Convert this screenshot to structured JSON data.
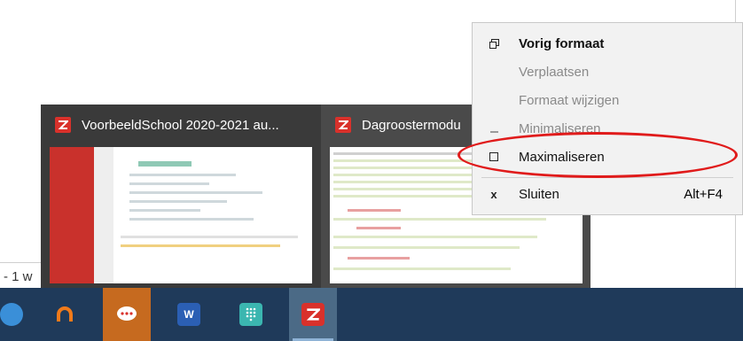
{
  "background": {
    "status_fragment": "- 1 w"
  },
  "thumbnails": [
    {
      "title": "VoorbeeldSchool 2020-2021 au...",
      "icon": "zermelo-logo-icon"
    },
    {
      "title": "Dagroostermodu",
      "icon": "zermelo-logo-icon"
    }
  ],
  "menu": {
    "items": [
      {
        "label": "Vorig formaat",
        "icon": "restore-icon",
        "shortcut": "",
        "enabled": true,
        "bold": true
      },
      {
        "label": "Verplaatsen",
        "icon": "",
        "shortcut": "",
        "enabled": false
      },
      {
        "label": "Formaat wijzigen",
        "icon": "",
        "shortcut": "",
        "enabled": false
      },
      {
        "label": "Minimaliseren",
        "icon": "minimize-icon",
        "shortcut": "",
        "enabled": false
      },
      {
        "label": "Maximaliseren",
        "icon": "maximize-icon",
        "shortcut": "",
        "enabled": true
      },
      {
        "label": "Sluiten",
        "icon": "close-icon",
        "shortcut": "Alt+F4",
        "enabled": true
      }
    ],
    "highlighted_item": "Maximaliseren"
  },
  "taskbar": {
    "apps": [
      {
        "name": "edge-icon"
      },
      {
        "name": "ccleaner-icon"
      },
      {
        "name": "rocketchat-icon"
      },
      {
        "name": "word-icon",
        "text": "W"
      },
      {
        "name": "keypad-icon"
      },
      {
        "name": "zermelo-icon",
        "active": true
      }
    ]
  },
  "colors": {
    "taskbar": "#1f3a5a",
    "highlight": "#e01b1b",
    "app_red": "#d9312b",
    "menu_bg": "#f2f2f2"
  }
}
